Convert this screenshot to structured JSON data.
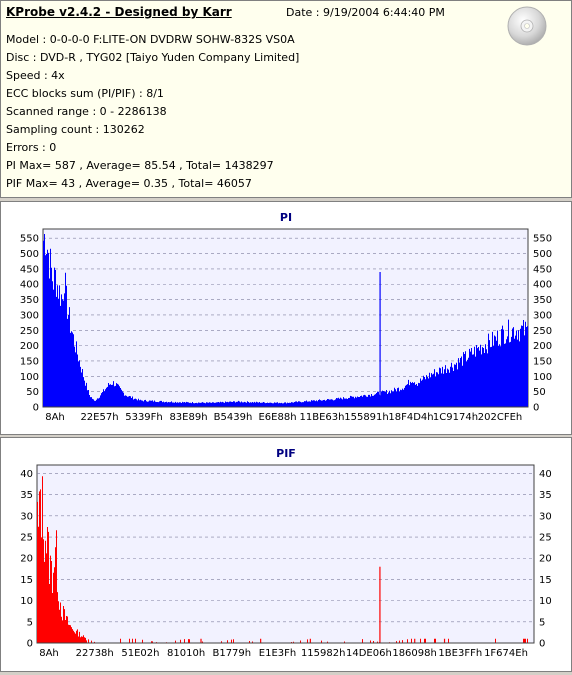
{
  "header": {
    "title": "KProbe v2.4.2 - Designed by Karr",
    "date": "Date : 9/19/2004 6:44:40 PM",
    "lines": [
      "Model : 0-0-0-0 F:LITE-ON DVDRW SOHW-832S  VS0A",
      "Disc : DVD-R , TYG02 [Taiyo Yuden Company Limited]",
      "Speed : 4x",
      "ECC blocks sum (PI/PIF) : 8/1",
      "Scanned range : 0 - 2286138",
      "Sampling count : 130262",
      "Errors : 0",
      "PI Max= 587 , Average= 85.54 , Total= 1438297",
      "PIF Max= 43 , Average= 0.35 , Total= 46057"
    ],
    "icon": "cd-disc-icon"
  },
  "chart_data": [
    {
      "type": "area",
      "title": "PI",
      "color": "#0000ff",
      "ylim": [
        0,
        580
      ],
      "yticks": [
        0,
        50,
        100,
        150,
        200,
        250,
        300,
        350,
        400,
        450,
        500,
        550
      ],
      "xticks": [
        "8Ah",
        "22E57h",
        "5339Fh",
        "83E89h",
        "B5439h",
        "E6E88h",
        "11BE63h",
        "155891h",
        "18F4D4h",
        "1C9174h",
        "202CFEh"
      ],
      "grid": true,
      "points": [
        [
          0,
          560
        ],
        [
          0.004,
          580
        ],
        [
          0.01,
          520
        ],
        [
          0.015,
          470
        ],
        [
          0.02,
          420
        ],
        [
          0.025,
          440
        ],
        [
          0.03,
          400
        ],
        [
          0.035,
          380
        ],
        [
          0.04,
          360
        ],
        [
          0.043,
          450
        ],
        [
          0.047,
          360
        ],
        [
          0.055,
          280
        ],
        [
          0.065,
          210
        ],
        [
          0.075,
          150
        ],
        [
          0.085,
          90
        ],
        [
          0.095,
          40
        ],
        [
          0.105,
          20
        ],
        [
          0.115,
          35
        ],
        [
          0.125,
          55
        ],
        [
          0.135,
          75
        ],
        [
          0.143,
          82
        ],
        [
          0.15,
          75
        ],
        [
          0.16,
          55
        ],
        [
          0.17,
          40
        ],
        [
          0.185,
          30
        ],
        [
          0.2,
          22
        ],
        [
          0.25,
          18
        ],
        [
          0.3,
          15
        ],
        [
          0.35,
          14
        ],
        [
          0.4,
          18
        ],
        [
          0.45,
          15
        ],
        [
          0.5,
          14
        ],
        [
          0.55,
          20
        ],
        [
          0.6,
          26
        ],
        [
          0.65,
          36
        ],
        [
          0.7,
          48
        ],
        [
          0.72,
          55
        ],
        [
          0.74,
          65
        ],
        [
          0.75,
          75
        ],
        [
          0.76,
          95
        ],
        [
          0.77,
          80
        ],
        [
          0.8,
          110
        ],
        [
          0.85,
          145
        ],
        [
          0.88,
          175
        ],
        [
          0.9,
          200
        ],
        [
          0.93,
          225
        ],
        [
          0.95,
          250
        ],
        [
          0.97,
          260
        ],
        [
          1.0,
          255
        ]
      ],
      "spikes": [
        [
          0.695,
          440
        ]
      ]
    },
    {
      "type": "bar",
      "title": "PIF",
      "color": "#ff0000",
      "ylim": [
        0,
        42
      ],
      "yticks": [
        0,
        5,
        10,
        15,
        20,
        25,
        30,
        35,
        40
      ],
      "xticks": [
        "8Ah",
        "22738h",
        "51E02h",
        "81010h",
        "B1779h",
        "E1E3Fh",
        "115982h",
        "14DE06h",
        "186098h",
        "1BE3FFh",
        "1F674Eh"
      ],
      "grid": true,
      "points": [
        [
          0,
          35
        ],
        [
          0.003,
          30
        ],
        [
          0.006,
          43
        ],
        [
          0.01,
          38
        ],
        [
          0.015,
          32
        ],
        [
          0.02,
          28
        ],
        [
          0.025,
          22
        ],
        [
          0.03,
          20
        ],
        [
          0.035,
          26
        ],
        [
          0.038,
          25
        ],
        [
          0.043,
          14
        ],
        [
          0.05,
          9
        ],
        [
          0.06,
          6
        ],
        [
          0.07,
          4
        ],
        [
          0.08,
          3
        ],
        [
          0.09,
          2
        ],
        [
          0.1,
          1
        ],
        [
          0.12,
          0
        ],
        [
          0.16,
          1
        ],
        [
          0.2,
          1
        ],
        [
          0.25,
          0
        ],
        [
          0.3,
          1
        ],
        [
          0.35,
          0
        ],
        [
          0.4,
          1
        ],
        [
          0.45,
          0
        ],
        [
          0.5,
          0
        ],
        [
          0.55,
          1
        ],
        [
          0.6,
          0
        ],
        [
          0.65,
          1
        ],
        [
          0.7,
          0
        ],
        [
          0.75,
          1
        ],
        [
          0.8,
          1
        ],
        [
          0.85,
          1
        ],
        [
          0.9,
          1
        ],
        [
          0.95,
          1
        ],
        [
          1.0,
          1
        ]
      ],
      "spikes": [
        [
          0.69,
          18
        ],
        [
          0.33,
          1
        ],
        [
          0.45,
          1
        ],
        [
          0.55,
          1
        ],
        [
          0.76,
          1
        ],
        [
          0.82,
          1
        ]
      ]
    }
  ]
}
